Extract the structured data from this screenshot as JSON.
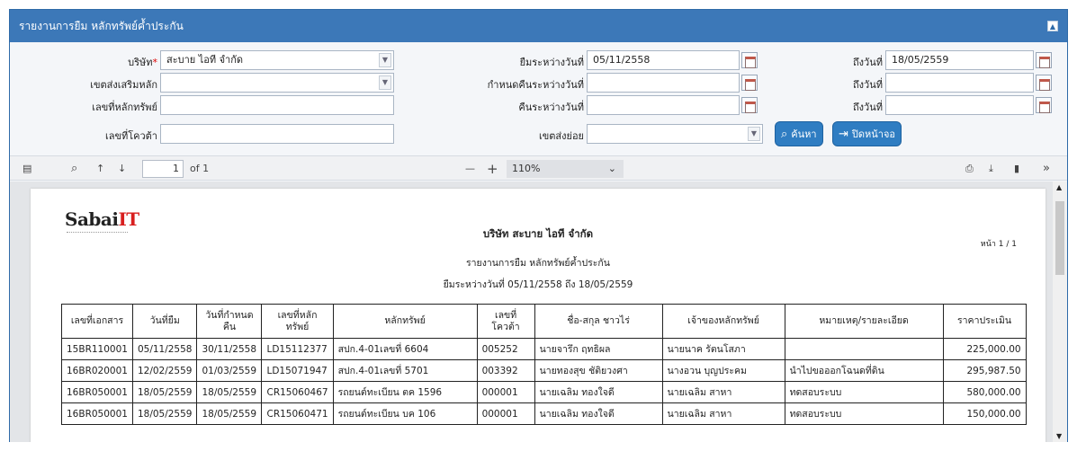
{
  "panel": {
    "title": "รายงานการยืม หลักทรัพย์ค้ำประกัน",
    "collapse_icon": "collapse-up-icon"
  },
  "form": {
    "company_label": "บริษัท",
    "company_required": "*",
    "company_value": "สะบาย ไอที จำกัด",
    "collateral_zone_label": "เขตส่งเสริมหลัก",
    "collateral_zone_value": "",
    "asset_no_label": "เลขที่หลักทรัพย์",
    "asset_no_value": "",
    "quota_no_label": "เลขที่โควต้า",
    "quota_no_value": "",
    "borrow_between_label": "ยืมระหว่างวันที่",
    "borrow_from": "05/11/2558",
    "due_between_label": "กำหนดคืนระหว่างวันที่",
    "due_from": "",
    "return_between_label": "คืนระหว่างวันที่",
    "return_from": "",
    "sub_zone_label": "เขตส่งย่อย",
    "sub_zone_value": "",
    "to_label": "ถึงวันที่",
    "borrow_to": "18/05/2559",
    "due_to": "",
    "return_to": "",
    "search_button": "ค้นหา",
    "close_button": "ปิดหน้าจอ"
  },
  "toolbar": {
    "page_current": "1",
    "page_of": "of 1",
    "zoom": "110%",
    "minus": "—",
    "plus": "+"
  },
  "report": {
    "logo_text": "Sabai",
    "logo_accent": "IT",
    "company": "บริษัท สะบาย ไอที จำกัด",
    "title": "รายงานการยืม หลักทรัพย์ค้ำประกัน",
    "range": "ยืมระหว่างวันที่ 05/11/2558 ถึง 18/05/2559",
    "page_no": "หน้า 1 / 1",
    "headers": [
      [
        "เลขที่เอกสาร"
      ],
      [
        "วันที่ยืม"
      ],
      [
        "วันที่กำหนด",
        "คืน"
      ],
      [
        "เลขที่หลัก",
        "ทรัพย์"
      ],
      [
        "หลักทรัพย์"
      ],
      [
        "เลขที่",
        "โควต้า"
      ],
      [
        "ชื่อ-สกุล ชาวไร่"
      ],
      [
        "เจ้าของหลักทรัพย์"
      ],
      [
        "หมายเหตุ/รายละเอียด"
      ],
      [
        "ราคาประเมิน"
      ]
    ],
    "rows": [
      [
        "15BR110001",
        "05/11/2558",
        "30/11/2558",
        "LD15112377",
        "สปก.4-01เลขที่ 6604",
        "005252",
        "นายจารึก ฤทธิผล",
        "นายนาค รัตนโสภา",
        "",
        "225,000.00"
      ],
      [
        "16BR020001",
        "12/02/2559",
        "01/03/2559",
        "LD15071947",
        "สปก.4-01เลขที่ 5701",
        "003392",
        "นายทองสุข ชัติยวงศา",
        "นางอวน บุญประคม",
        "นำไปขอออกโฉนดที่ดิน",
        "295,987.50"
      ],
      [
        "16BR050001",
        "18/05/2559",
        "18/05/2559",
        "CR15060467",
        "รถยนต์ทะเบียน ตค 1596",
        "000001",
        "นายเฉลิม ทองใจดี",
        "นายเฉลิม สาหา",
        "ทดสอบระบบ",
        "580,000.00"
      ],
      [
        "16BR050001",
        "18/05/2559",
        "18/05/2559",
        "CR15060471",
        "รถยนต์ทะเบียน บค 106",
        "000001",
        "นายเฉลิม ทองใจดี",
        "นายเฉลิม สาหา",
        "ทดสอบระบบ",
        "150,000.00"
      ]
    ]
  }
}
